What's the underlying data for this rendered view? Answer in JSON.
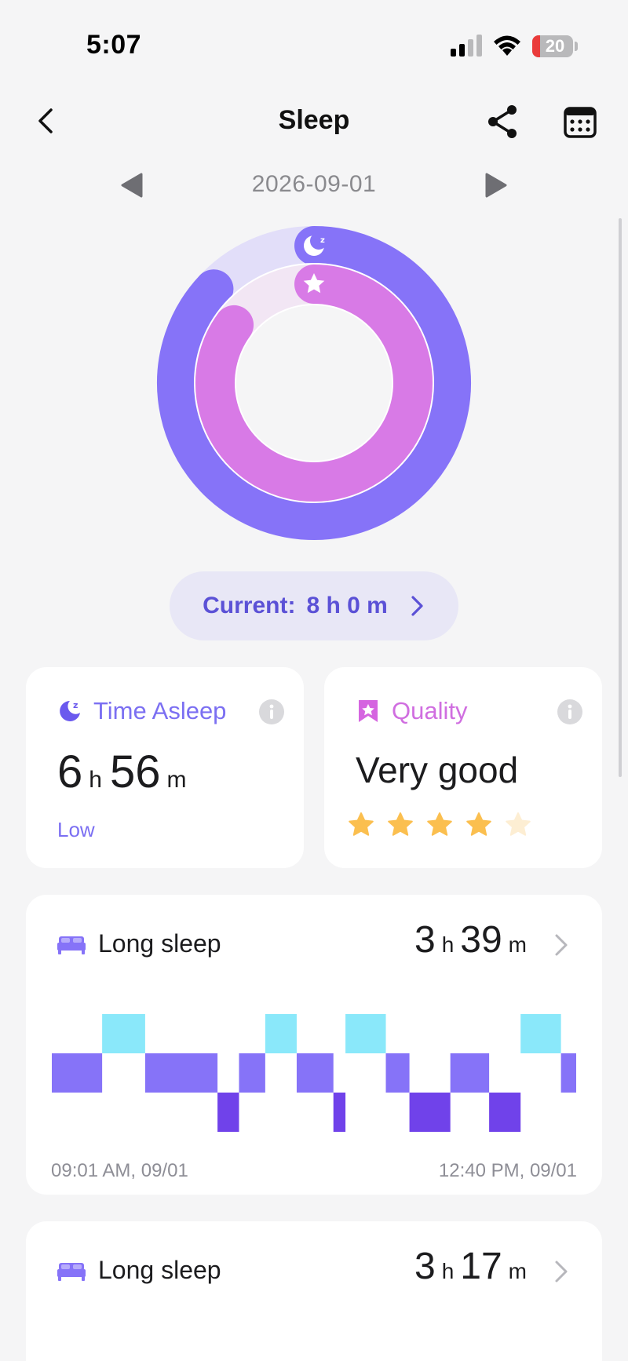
{
  "status_bar": {
    "time": "5:07",
    "battery": "20",
    "battery_level": 0.2
  },
  "nav": {
    "title": "Sleep"
  },
  "date": {
    "value": "2026-09-01"
  },
  "ring": {
    "outer_progress": 0.87,
    "inner_progress": 0.85,
    "outer_color": "#8673f8",
    "outer_track": "#e2def9",
    "inner_color": "#d87ae6",
    "inner_track": "#f2e6f4"
  },
  "current": {
    "label": "Current:",
    "value": "8 h 0 m"
  },
  "time_asleep": {
    "label": "Time Asleep",
    "hours": "6",
    "hours_unit": "h",
    "minutes": "56",
    "minutes_unit": "m",
    "status": "Low"
  },
  "quality": {
    "label": "Quality",
    "value": "Very good",
    "rating": 4,
    "max_rating": 5
  },
  "long_sleeps": [
    {
      "label": "Long sleep",
      "hours": "3",
      "hours_unit": "h",
      "minutes": "39",
      "minutes_unit": "m",
      "start": "09:01 AM, 09/01",
      "end": "12:40 PM, 09/01",
      "stages": [
        {
          "stage": "light",
          "start": 0.0,
          "end": 0.096
        },
        {
          "stage": "awake",
          "start": 0.096,
          "end": 0.178
        },
        {
          "stage": "light",
          "start": 0.178,
          "end": 0.316
        },
        {
          "stage": "deep",
          "start": 0.316,
          "end": 0.357
        },
        {
          "stage": "light",
          "start": 0.357,
          "end": 0.407
        },
        {
          "stage": "awake",
          "start": 0.407,
          "end": 0.467
        },
        {
          "stage": "light",
          "start": 0.467,
          "end": 0.537
        },
        {
          "stage": "deep",
          "start": 0.537,
          "end": 0.56
        },
        {
          "stage": "awake",
          "start": 0.56,
          "end": 0.637
        },
        {
          "stage": "light",
          "start": 0.637,
          "end": 0.682
        },
        {
          "stage": "deep",
          "start": 0.682,
          "end": 0.76
        },
        {
          "stage": "light",
          "start": 0.76,
          "end": 0.834
        },
        {
          "stage": "deep",
          "start": 0.834,
          "end": 0.894
        },
        {
          "stage": "awake",
          "start": 0.894,
          "end": 0.971
        },
        {
          "stage": "light",
          "start": 0.971,
          "end": 1.0
        }
      ],
      "stage_colors": {
        "awake": "#8ae8fa",
        "light": "#8673f8",
        "deep": "#7042ea"
      }
    },
    {
      "label": "Long sleep",
      "hours": "3",
      "hours_unit": "h",
      "minutes": "17",
      "minutes_unit": "m"
    }
  ],
  "icons": {
    "back": "chevron-left-icon",
    "share": "share-icon",
    "calendar": "calendar-icon",
    "prev": "triangle-left-icon",
    "next": "triangle-right-icon",
    "moon": "moon-icon",
    "star": "star-icon",
    "info": "info-icon",
    "bookmark": "bookmark-star-icon",
    "bed": "bed-icon"
  }
}
